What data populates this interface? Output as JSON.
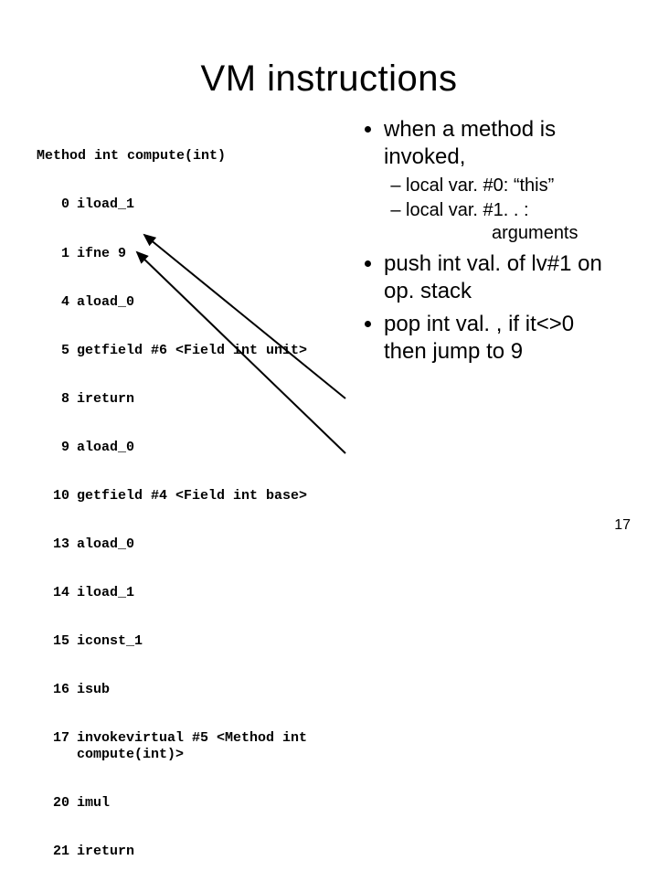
{
  "title": "VM instructions",
  "page_number": "17",
  "bytecode": {
    "header": "Method int compute(int)",
    "lines": [
      {
        "offset": "0",
        "instr": "iload_1"
      },
      {
        "offset": "1",
        "instr": "ifne 9"
      },
      {
        "offset": "4",
        "instr": "aload_0"
      },
      {
        "offset": "5",
        "instr": "getfield #6 <Field int unit>"
      },
      {
        "offset": "8",
        "instr": "ireturn"
      },
      {
        "offset": "9",
        "instr": "aload_0"
      },
      {
        "offset": "10",
        "instr": "getfield #4 <Field int base>"
      },
      {
        "offset": "13",
        "instr": "aload_0"
      },
      {
        "offset": "14",
        "instr": "iload_1"
      },
      {
        "offset": "15",
        "instr": "iconst_1"
      },
      {
        "offset": "16",
        "instr": "isub"
      },
      {
        "offset": "17",
        "instr": "invokevirtual #5 <Method int compute(int)>"
      },
      {
        "offset": "20",
        "instr": "imul"
      },
      {
        "offset": "21",
        "instr": "ireturn"
      }
    ]
  },
  "bullets": {
    "b1": "when a method is invoked,",
    "b1_sub1": "local var. #0: “this”",
    "b1_sub2": "local var. #1. . :",
    "b1_sub2_extra": "arguments",
    "b2": "push int val. of lv#1 on op. stack",
    "b3": "pop int val. , if it<>0 then jump to 9"
  }
}
